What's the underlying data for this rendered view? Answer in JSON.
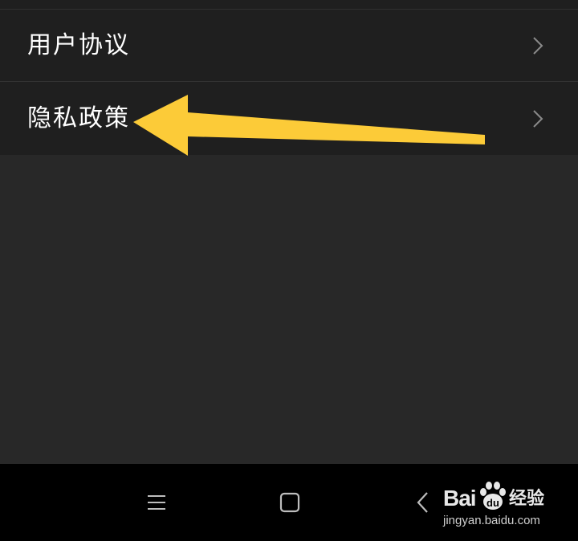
{
  "settings_list": {
    "items": [
      {
        "label": "用户协议",
        "icon": "chevron-right-icon"
      },
      {
        "label": "隐私政策",
        "icon": "chevron-right-icon"
      }
    ]
  },
  "annotation": {
    "icon": "arrow-left-icon",
    "color": "#fccb38"
  },
  "nav_bar": {
    "buttons": [
      {
        "icon": "menu-icon"
      },
      {
        "icon": "home-square-icon"
      },
      {
        "icon": "back-chevron-icon"
      }
    ]
  },
  "watermark": {
    "logo_text_left": "Bai",
    "logo_text_right": "",
    "tagline": "经验",
    "url": "jingyan.baidu.com",
    "icon": "baidu-paw-icon"
  },
  "colors": {
    "list_background": "#1f1f1f",
    "page_background": "#282828",
    "nav_background": "#000000",
    "text": "#ffffff",
    "arrow": "#fccb38"
  }
}
